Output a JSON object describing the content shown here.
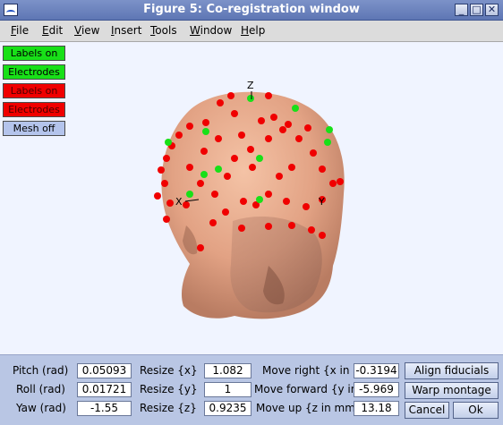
{
  "window": {
    "title": "Figure 5: Co-registration window",
    "controls": [
      "_",
      "□",
      "✕"
    ]
  },
  "menu": {
    "items": [
      {
        "label": "File",
        "underline": "F",
        "rest": "ile"
      },
      {
        "label": "Edit",
        "underline": "E",
        "rest": "dit"
      },
      {
        "label": "View",
        "underline": "V",
        "rest": "iew"
      },
      {
        "label": "Insert",
        "underline": "I",
        "rest": "nsert"
      },
      {
        "label": "Tools",
        "underline": "T",
        "rest": "ools"
      },
      {
        "label": "Window",
        "underline": "W",
        "rest": "indow"
      },
      {
        "label": "Help",
        "underline": "H",
        "rest": "elp"
      }
    ]
  },
  "side_buttons": [
    {
      "label": "Labels on",
      "color": "#18e018"
    },
    {
      "label": "Electrodes",
      "color": "#18e018"
    },
    {
      "label": "Labels on",
      "color": "#f00000"
    },
    {
      "label": "Electrodes",
      "color": "#f00000"
    },
    {
      "label": "Mesh off",
      "color": "#b4c4ec"
    }
  ],
  "plot": {
    "axis_labels": {
      "x": "X",
      "y": "Y",
      "z": "Z"
    },
    "head_color": "#e7a88a",
    "electrode_colors": {
      "green": "#18e018",
      "red": "#f00000"
    }
  },
  "panel": {
    "pitch": {
      "label": "Pitch (rad)",
      "value": "0.05093"
    },
    "roll": {
      "label": "Roll (rad)",
      "value": "0.01721"
    },
    "yaw": {
      "label": "Yaw (rad)",
      "value": "-1.55"
    },
    "resize_x": {
      "label": "Resize {x}",
      "value": "1.082"
    },
    "resize_y": {
      "label": "Resize {y}",
      "value": "1"
    },
    "resize_z": {
      "label": "Resize {z}",
      "value": "0.9235"
    },
    "move_right": {
      "label": "Move right {x in",
      "value": "-0.3194"
    },
    "move_forward": {
      "label": "Move forward {y in",
      "value": "-5.969"
    },
    "move_up": {
      "label": "Move up {z in mm}",
      "value": "13.18"
    },
    "align_fiducials": "Align fiducials",
    "warp_montage": "Warp montage",
    "cancel": "Cancel",
    "ok": "Ok"
  }
}
